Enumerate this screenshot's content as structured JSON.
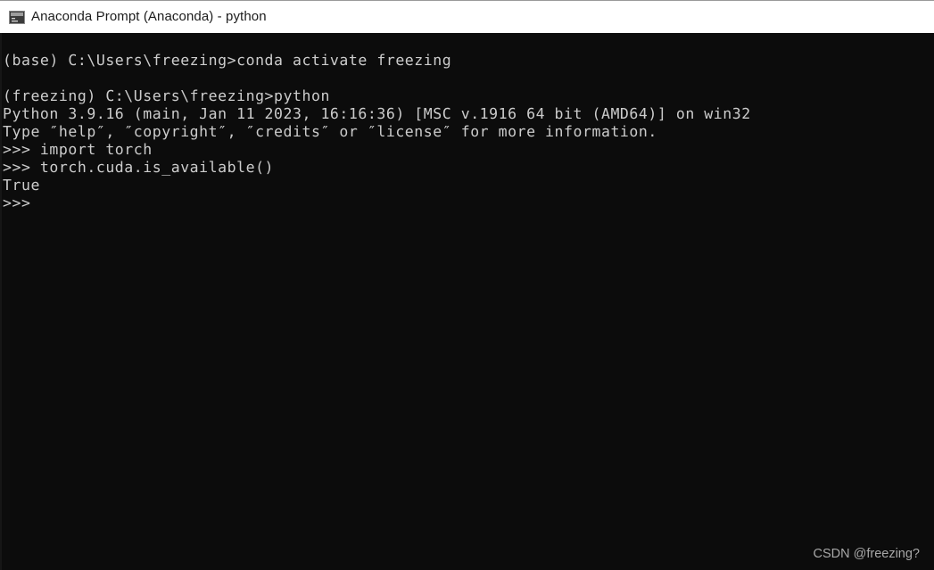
{
  "window": {
    "title": "Anaconda Prompt (Anaconda) - python",
    "icon": "console-window-icon",
    "titlebar_bg": "#ffffff",
    "titlebar_fg": "#1c1c1c",
    "terminal_bg": "#0c0c0c",
    "terminal_fg": "#cccccc"
  },
  "terminal": {
    "lines": [
      "(base) C:\\Users\\freezing>conda activate freezing",
      "",
      "(freezing) C:\\Users\\freezing>python",
      "Python 3.9.16 (main, Jan 11 2023, 16:16:36) [MSC v.1916 64 bit (AMD64)] on win32",
      "Type ″help″, ″copyright″, ″credits″ or ″license″ for more information.",
      ">>> import torch",
      ">>> torch.cuda.is_available()",
      "True",
      ">>> "
    ]
  },
  "watermark": {
    "text": "CSDN @freezing?",
    "color": "#b6b6b6"
  }
}
